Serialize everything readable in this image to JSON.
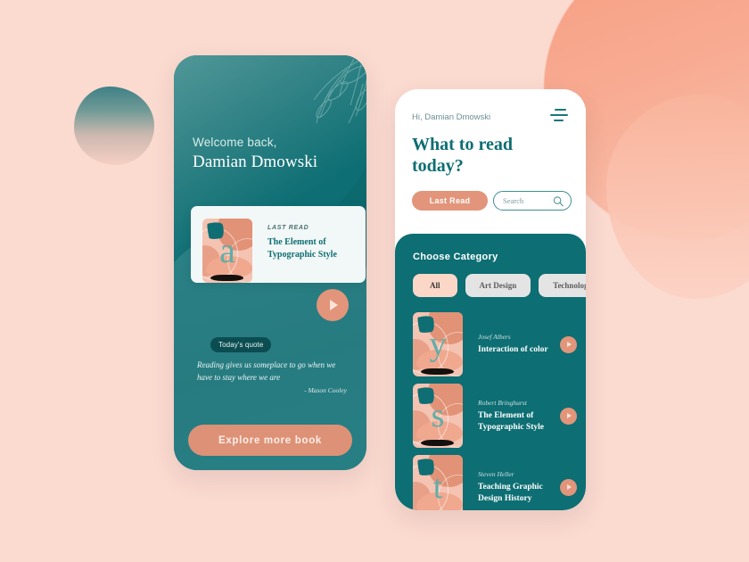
{
  "background": {
    "page_color": "#fbdad0",
    "accent_salmon": "#e2957a",
    "accent_teal": "#0d6e73"
  },
  "left_phone": {
    "welcome_label": "Welcome back,",
    "user_name": "Damian Dmowski",
    "last_read": {
      "label": "LAST READ",
      "title": "The Element of Typographic Style",
      "cover_letter": "a",
      "play_icon": "play-icon"
    },
    "quote": {
      "chip_label": "Today's quote",
      "text": "Reading gives us someplace to go when we have to stay where we are",
      "author": "- Mason Cooley"
    },
    "explore_button": "Explore more book",
    "leaf_icon": "leaf-branch-icon"
  },
  "right_phone": {
    "greeting": "Hi, Damian Dmowski",
    "menu_icon": "hamburger-menu-icon",
    "headline": "What to read today?",
    "last_read_pill": "Last Read",
    "search": {
      "placeholder": "Search",
      "value": "",
      "icon": "search-icon"
    },
    "category": {
      "title": "Choose Category",
      "chips": [
        {
          "label": "All",
          "active": true
        },
        {
          "label": "Art Design",
          "active": false
        },
        {
          "label": "Technology",
          "active": false
        }
      ]
    },
    "books": [
      {
        "author": "Josef Albers",
        "title": "Interaction of color",
        "cover_letter": "y",
        "play_icon": "play-icon"
      },
      {
        "author": "Robert Bringhurst",
        "title": "The Element of Typographic Style",
        "cover_letter": "s",
        "play_icon": "play-icon"
      },
      {
        "author": "Steven Heller",
        "title": "Teaching Graphic Design History",
        "cover_letter": "t",
        "play_icon": "play-icon"
      }
    ]
  }
}
